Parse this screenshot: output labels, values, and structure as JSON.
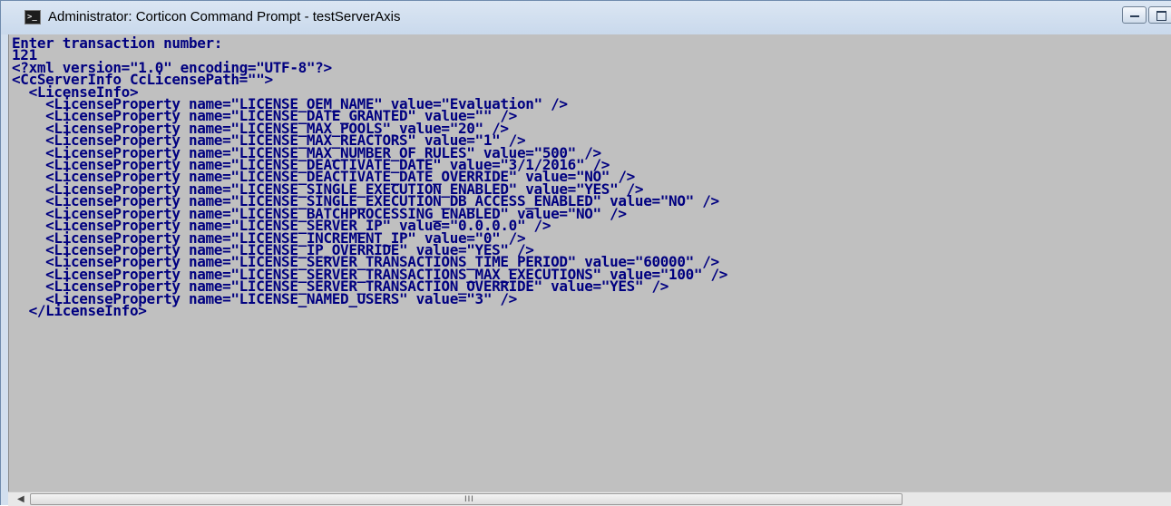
{
  "window": {
    "title": "Administrator: Corticon Command Prompt - testServerAxis",
    "icon": "command-prompt-icon"
  },
  "console": {
    "lines": [
      "Enter transaction number:",
      "121",
      "<?xml version=\"1.0\" encoding=\"UTF-8\"?>",
      "<CcServerInfo CcLicensePath=\"\">",
      "  <LicenseInfo>",
      "    <LicenseProperty name=\"LICENSE_OEM_NAME\" value=\"Evaluation\" />",
      "    <LicenseProperty name=\"LICENSE_DATE_GRANTED\" value=\"\" />",
      "    <LicenseProperty name=\"LICENSE_MAX_POOLS\" value=\"20\" />",
      "    <LicenseProperty name=\"LICENSE_MAX_REACTORS\" value=\"1\" />",
      "    <LicenseProperty name=\"LICENSE_MAX_NUMBER_OF_RULES\" value=\"500\" />",
      "    <LicenseProperty name=\"LICENSE_DEACTIVATE_DATE\" value=\"3/1/2016\" />",
      "    <LicenseProperty name=\"LICENSE_DEACTIVATE_DATE_OVERRIDE\" value=\"NO\" />",
      "    <LicenseProperty name=\"LICENSE_SINGLE_EXECUTION_ENABLED\" value=\"YES\" />",
      "    <LicenseProperty name=\"LICENSE_SINGLE_EXECUTION_DB_ACCESS_ENABLED\" value=\"NO\" />",
      "    <LicenseProperty name=\"LICENSE_BATCHPROCESSING_ENABLED\" value=\"NO\" />",
      "    <LicenseProperty name=\"LICENSE_SERVER_IP\" value=\"0.0.0.0\" />",
      "    <LicenseProperty name=\"LICENSE_INCREMENT_IP\" value=\"0\" />",
      "    <LicenseProperty name=\"LICENSE_IP_OVERRIDE\" value=\"YES\" />",
      "    <LicenseProperty name=\"LICENSE_SERVER_TRANSACTIONS_TIME_PERIOD\" value=\"60000\" />",
      "    <LicenseProperty name=\"LICENSE_SERVER_TRANSACTIONS_MAX_EXECUTIONS\" value=\"100\" />",
      "    <LicenseProperty name=\"LICENSE_SERVER_TRANSACTION_OVERRIDE\" value=\"YES\" />",
      "    <LicenseProperty name=\"LICENSE_NAMED_USERS\" value=\"3\" />",
      "  </LicenseInfo>"
    ],
    "text_color": "#000080",
    "background_color": "#c0c0c0"
  },
  "scrollbar": {
    "left_arrow": "◀",
    "thumb_grip": "III"
  }
}
